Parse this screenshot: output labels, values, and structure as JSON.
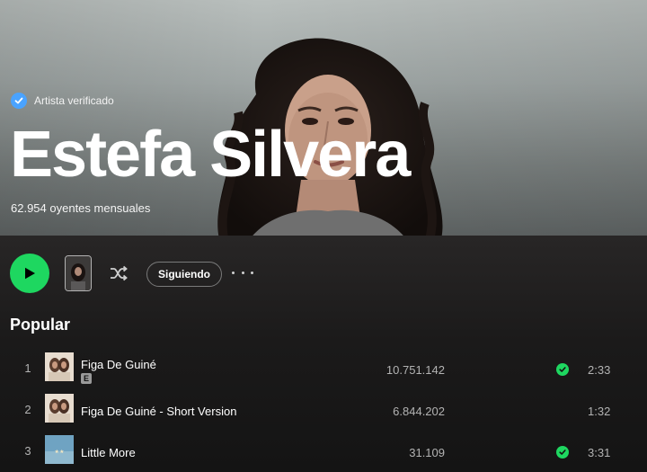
{
  "artist": {
    "verified_label": "Artista verificado",
    "name": "Estefa Silvera",
    "monthly_listeners": "62.954 oyentes mensuales"
  },
  "actions": {
    "follow_label": "Siguiendo"
  },
  "popular": {
    "title": "Popular",
    "tracks": [
      {
        "rank": "1",
        "title": "Figa De Guiné",
        "explicit": "E",
        "plays": "10.751.142",
        "saved": true,
        "duration": "2:33"
      },
      {
        "rank": "2",
        "title": "Figa De Guiné - Short Version",
        "explicit": "",
        "plays": "6.844.202",
        "saved": false,
        "duration": "1:32"
      },
      {
        "rank": "3",
        "title": "Little More",
        "explicit": "",
        "plays": "31.109",
        "saved": true,
        "duration": "3:31"
      }
    ]
  },
  "colors": {
    "accent": "#1ed760",
    "verified": "#4aa3ff",
    "background": "#121212"
  },
  "icons": [
    "verified-check-icon",
    "play-icon",
    "shuffle-icon",
    "more-options-icon",
    "saved-check-icon"
  ]
}
